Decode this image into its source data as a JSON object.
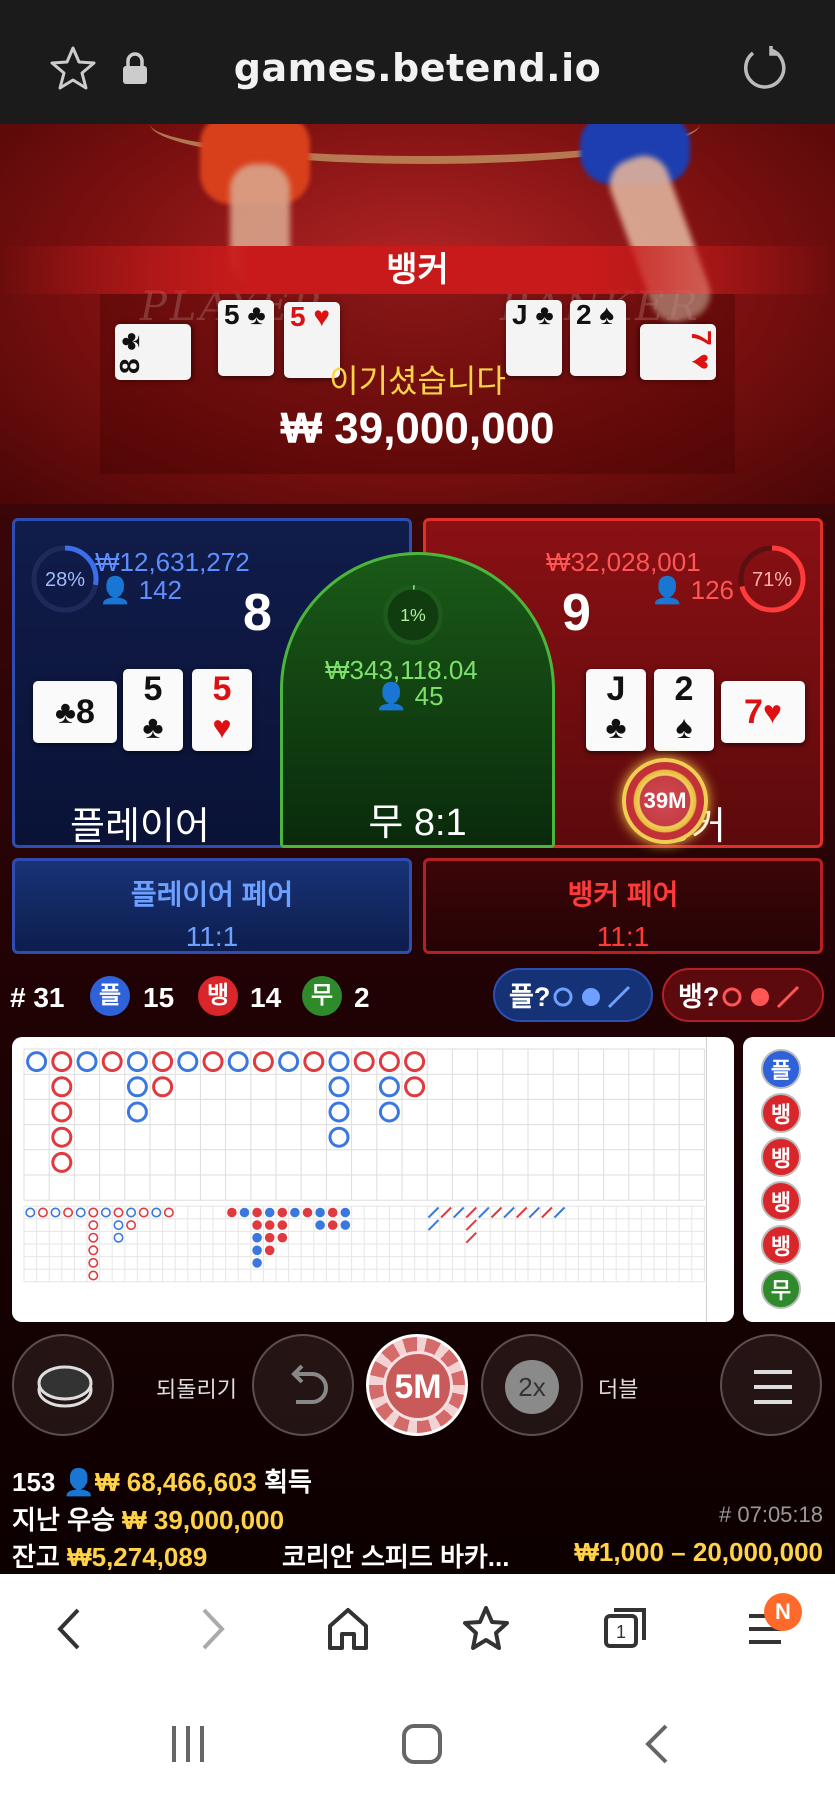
{
  "browser": {
    "url": "games.betend.io"
  },
  "video": {
    "banner": "뱅커",
    "win_message": "이기셨습니다",
    "win_amount": "₩ 39,000,000",
    "left_script": "PLAYER",
    "right_script": "BANKER",
    "player_cards": [
      "8 ♣",
      "5 ♣",
      "5 ♥"
    ],
    "banker_cards": [
      "J ♣",
      "2 ♠",
      "7 ♥"
    ]
  },
  "player": {
    "percent": "28%",
    "amount": "₩12,631,272",
    "bettors": "142",
    "score": "8",
    "cards": [
      {
        "rank": "8",
        "suit": "♣",
        "color": "black",
        "sideways": true
      },
      {
        "rank": "5",
        "suit": "♣",
        "color": "black",
        "sideways": false
      },
      {
        "rank": "5",
        "suit": "♥",
        "color": "red",
        "sideways": false
      }
    ],
    "label": "플레이어",
    "percent_value": 0.28
  },
  "tie": {
    "percent": "1%",
    "amount": "₩343,118.04",
    "bettors": "45",
    "label": "무 8:1",
    "percent_value": 0.01
  },
  "banker": {
    "percent": "71%",
    "amount": "₩32,028,001",
    "bettors": "126",
    "score": "9",
    "cards": [
      {
        "rank": "J",
        "suit": "♣",
        "color": "black",
        "sideways": false
      },
      {
        "rank": "2",
        "suit": "♠",
        "color": "black",
        "sideways": false
      },
      {
        "rank": "7",
        "suit": "♥",
        "color": "red",
        "sideways": true
      }
    ],
    "label": "뱅커",
    "chip": "39M",
    "percent_value": 0.71
  },
  "pairs": {
    "player_pair": {
      "label": "플레이어 페어",
      "odds": "11:1"
    },
    "banker_pair": {
      "label": "뱅커 페어",
      "odds": "11:1"
    }
  },
  "stats": {
    "round": "# 31",
    "player_icon": "플",
    "player_count": "15",
    "banker_icon": "뱅",
    "banker_count": "14",
    "tie_icon": "무",
    "tie_count": "2",
    "ask_player": "플?",
    "ask_banker": "뱅?"
  },
  "bead_road": [
    "플",
    "뱅",
    "뱅",
    "뱅",
    "뱅",
    "무"
  ],
  "controls": {
    "undo_label": "되돌리기",
    "chip_value": "5M",
    "double_icon": "2x",
    "double_label": "더블"
  },
  "footer": {
    "winners_count": "153",
    "total_won": "₩ 68,466,603",
    "won_suffix": "획득",
    "last_win_label": "지난 우승",
    "last_win_amount": "₩ 39,000,000",
    "game_id": "# 07:05:18",
    "balance_label": "잔고",
    "balance_amount": "₩5,274,089",
    "table_name": "코리안 스피드 바카...",
    "limits": "₩1,000 – 20,000,000"
  },
  "navbar": {
    "badge": "N"
  },
  "colors": {
    "player_blue": "#2f4db0",
    "banker_red": "#e0302c",
    "tie_green": "#4cb63c",
    "gold": "#ffd24a"
  }
}
